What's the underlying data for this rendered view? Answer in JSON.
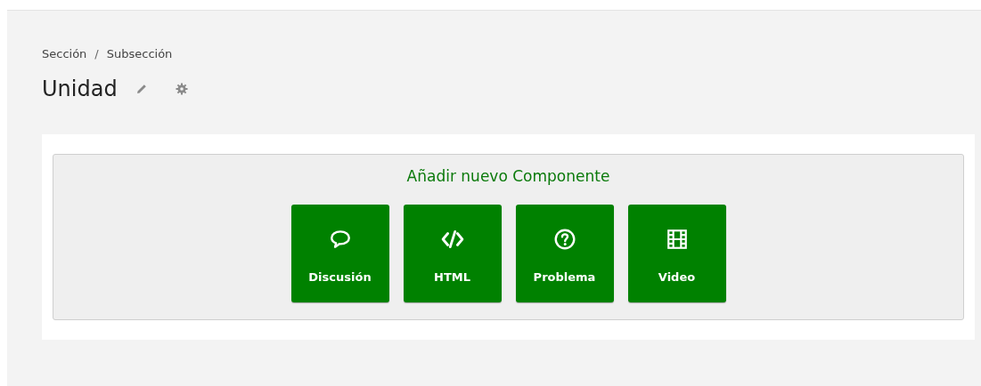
{
  "breadcrumb": {
    "items": [
      "Sección",
      "Subsección"
    ],
    "separator": "/"
  },
  "title": "Unidad",
  "add_component": {
    "heading": "Añadir nuevo Componente",
    "buttons": [
      {
        "kind": "discussion",
        "label": "Discusión"
      },
      {
        "kind": "html",
        "label": "HTML"
      },
      {
        "kind": "problem",
        "label": "Problema"
      },
      {
        "kind": "video",
        "label": "Video"
      }
    ]
  }
}
